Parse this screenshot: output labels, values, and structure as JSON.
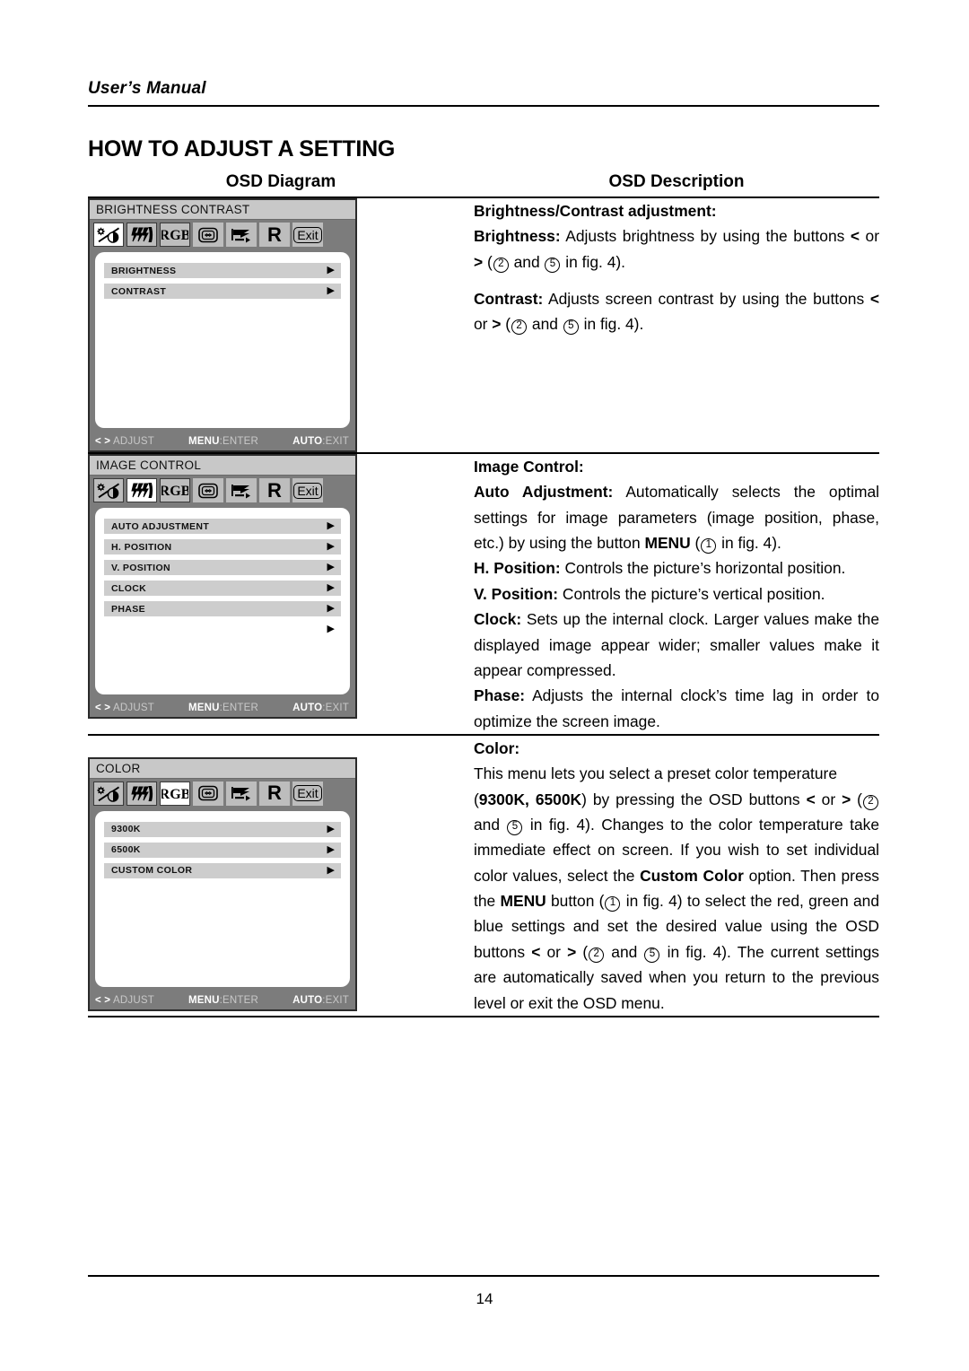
{
  "header": {
    "running_head": "User’s Manual",
    "chapter_title": "HOW TO ADJUST A SETTING"
  },
  "table": {
    "col_headers": {
      "diagram": "OSD Diagram",
      "description": "OSD Description"
    }
  },
  "osd_icons": [
    {
      "name": "brightness-contrast-icon",
      "glyph": "sun-halfcircle"
    },
    {
      "name": "image-control-icon",
      "glyph": "lightning-bars"
    },
    {
      "name": "rgb-color-icon",
      "glyph": "RGB"
    },
    {
      "name": "position-icon",
      "glyph": "screen-arrows"
    },
    {
      "name": "osd-language-icon",
      "glyph": "flag-arrow"
    },
    {
      "name": "reset-icon",
      "glyph": "R"
    },
    {
      "name": "exit-icon",
      "glyph": "Exit"
    }
  ],
  "osd_footer": {
    "adjust_keys": "< >",
    "adjust_label": "ADJUST",
    "menu_key": "MENU",
    "menu_label": ":ENTER",
    "auto_key": "AUTO",
    "auto_label": ":EXIT"
  },
  "diagrams": [
    {
      "id": "brightness-contrast",
      "title": "BRIGHTNESS CONTRAST",
      "selected_icon_index": 0,
      "rows": [
        {
          "label": "BRIGHTNESS",
          "arrow": "▶"
        },
        {
          "label": "CONTRAST",
          "arrow": "▶"
        }
      ]
    },
    {
      "id": "image-control",
      "title": "IMAGE CONTROL",
      "selected_icon_index": 1,
      "rows": [
        {
          "label": "AUTO ADJUSTMENT",
          "arrow": "▶"
        },
        {
          "label": "H. POSITION",
          "arrow": "▶"
        },
        {
          "label": "V. POSITION",
          "arrow": "▶"
        },
        {
          "label": "CLOCK",
          "arrow": "▶"
        },
        {
          "label": "PHASE",
          "arrow": "▶"
        },
        {
          "label": "",
          "arrow": "▶"
        }
      ]
    },
    {
      "id": "color",
      "title": "COLOR",
      "selected_icon_index": 2,
      "rows": [
        {
          "label": "9300K",
          "arrow": "▶"
        },
        {
          "label": "6500K",
          "arrow": "▶"
        },
        {
          "label": "CUSTOM COLOR",
          "arrow": "▶"
        }
      ]
    }
  ],
  "descriptions": {
    "brightness_contrast": {
      "heading": "Brightness/Contrast adjustment:",
      "p1_label": "Brightness:",
      "p1_a": " Adjusts brightness by using the buttons ",
      "p1_lt": "<",
      "p1_or": " or ",
      "p1_gt": ">",
      "p1_b": " (",
      "p1_n1": "2",
      "p1_c": " and ",
      "p1_n2": "5",
      "p1_d": " in fig. 4).",
      "p2_label": "Contrast:",
      "p2_a": " Adjusts screen contrast by using the buttons ",
      "p2_lt": "<",
      "p2_or": " or ",
      "p2_gt": ">",
      "p2_b": " (",
      "p2_n1": "2",
      "p2_c": " and ",
      "p2_n2": "5",
      "p2_d": " in fig. 4)."
    },
    "image_control": {
      "heading": "Image Control:",
      "auto_label": "Auto Adjustment:",
      "auto_a": " Automatically selects the optimal settings for image parameters (image position, phase, etc.) by using the button ",
      "auto_menu": "MENU",
      "auto_b": " (",
      "auto_n1": "1",
      "auto_c": " in fig. 4).",
      "hpos_label": "H. Position:",
      "hpos_text": " Controls the picture’s horizontal position.",
      "vpos_label": "V. Position:",
      "vpos_text": " Controls the picture’s vertical position.",
      "clock_label": "Clock:",
      "clock_text": " Sets up the internal clock. Larger values make the displayed image appear wider; smaller values make it appear compressed.",
      "phase_label": "Phase:",
      "phase_text": " Adjusts the internal clock’s time lag in order to optimize the screen image."
    },
    "color": {
      "heading": "Color:",
      "intro": "This menu lets you select a preset color temperature",
      "c_open": "(",
      "c_9300": "9300K,",
      "c_6500": "6500K",
      "c_close": ") by pressing the OSD buttons ",
      "c_lt": "<",
      "c_or": " or ",
      "c_gt": ">",
      "c_paren": " (",
      "c_n1": "2",
      "c_and": " and ",
      "c_n2": "5",
      "c_fig": " in fig. 4). Changes to the color temperature take immediate effect on screen. If you wish to set individual color values, select the ",
      "custom_label": "Custom Color",
      "c_then": " option. Then press the ",
      "menu_label": "MENU",
      "c_btn": " button (",
      "c_n3": "1",
      "c_sel": " in fig. 4) to select the red, green and blue settings and set the desired value using the OSD buttons ",
      "c_lt2": "<",
      "c_or2": " or ",
      "c_gt2": ">",
      "c_paren2": " (",
      "c_n4": "2",
      "c_and2": " and ",
      "c_n5": "5",
      "c_tail": " in fig. 4). The current settings are automatically saved when you return to the previous level or exit the OSD menu."
    }
  },
  "footer": {
    "page_number": "14"
  }
}
